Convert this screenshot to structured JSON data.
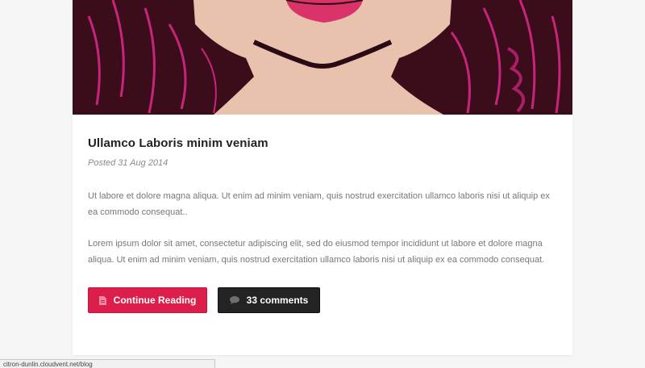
{
  "post": {
    "title": "Ullamco Laboris minim veniam",
    "date": "Posted 31 Aug 2014",
    "paragraphs": [
      "Ut labore et dolore magna aliqua. Ut enim ad minim veniam, quis nostrud exercitation ullamco laboris nisi ut aliquip ex ea commodo consequat..",
      "Lorem ipsum dolor sit amet, consectetur adipiscing elit, sed do eiusmod tempor incididunt ut labore et dolore magna aliqua. Ut enim ad minim veniam, quis nostrud exercitation ullamco laboris nisi ut aliquip ex ea commodo consequat."
    ],
    "continue_label": "Continue Reading",
    "continue_icon": "document-icon",
    "comments_label": "33 comments",
    "comments_icon": "speech-bubble-icon"
  },
  "status_bar": {
    "url": "citron-dunlin.cloudvent.net/blog"
  },
  "colors": {
    "accent": "#dc1e4a",
    "dark_button": "#232323",
    "page_background": "#f5f5f5"
  }
}
